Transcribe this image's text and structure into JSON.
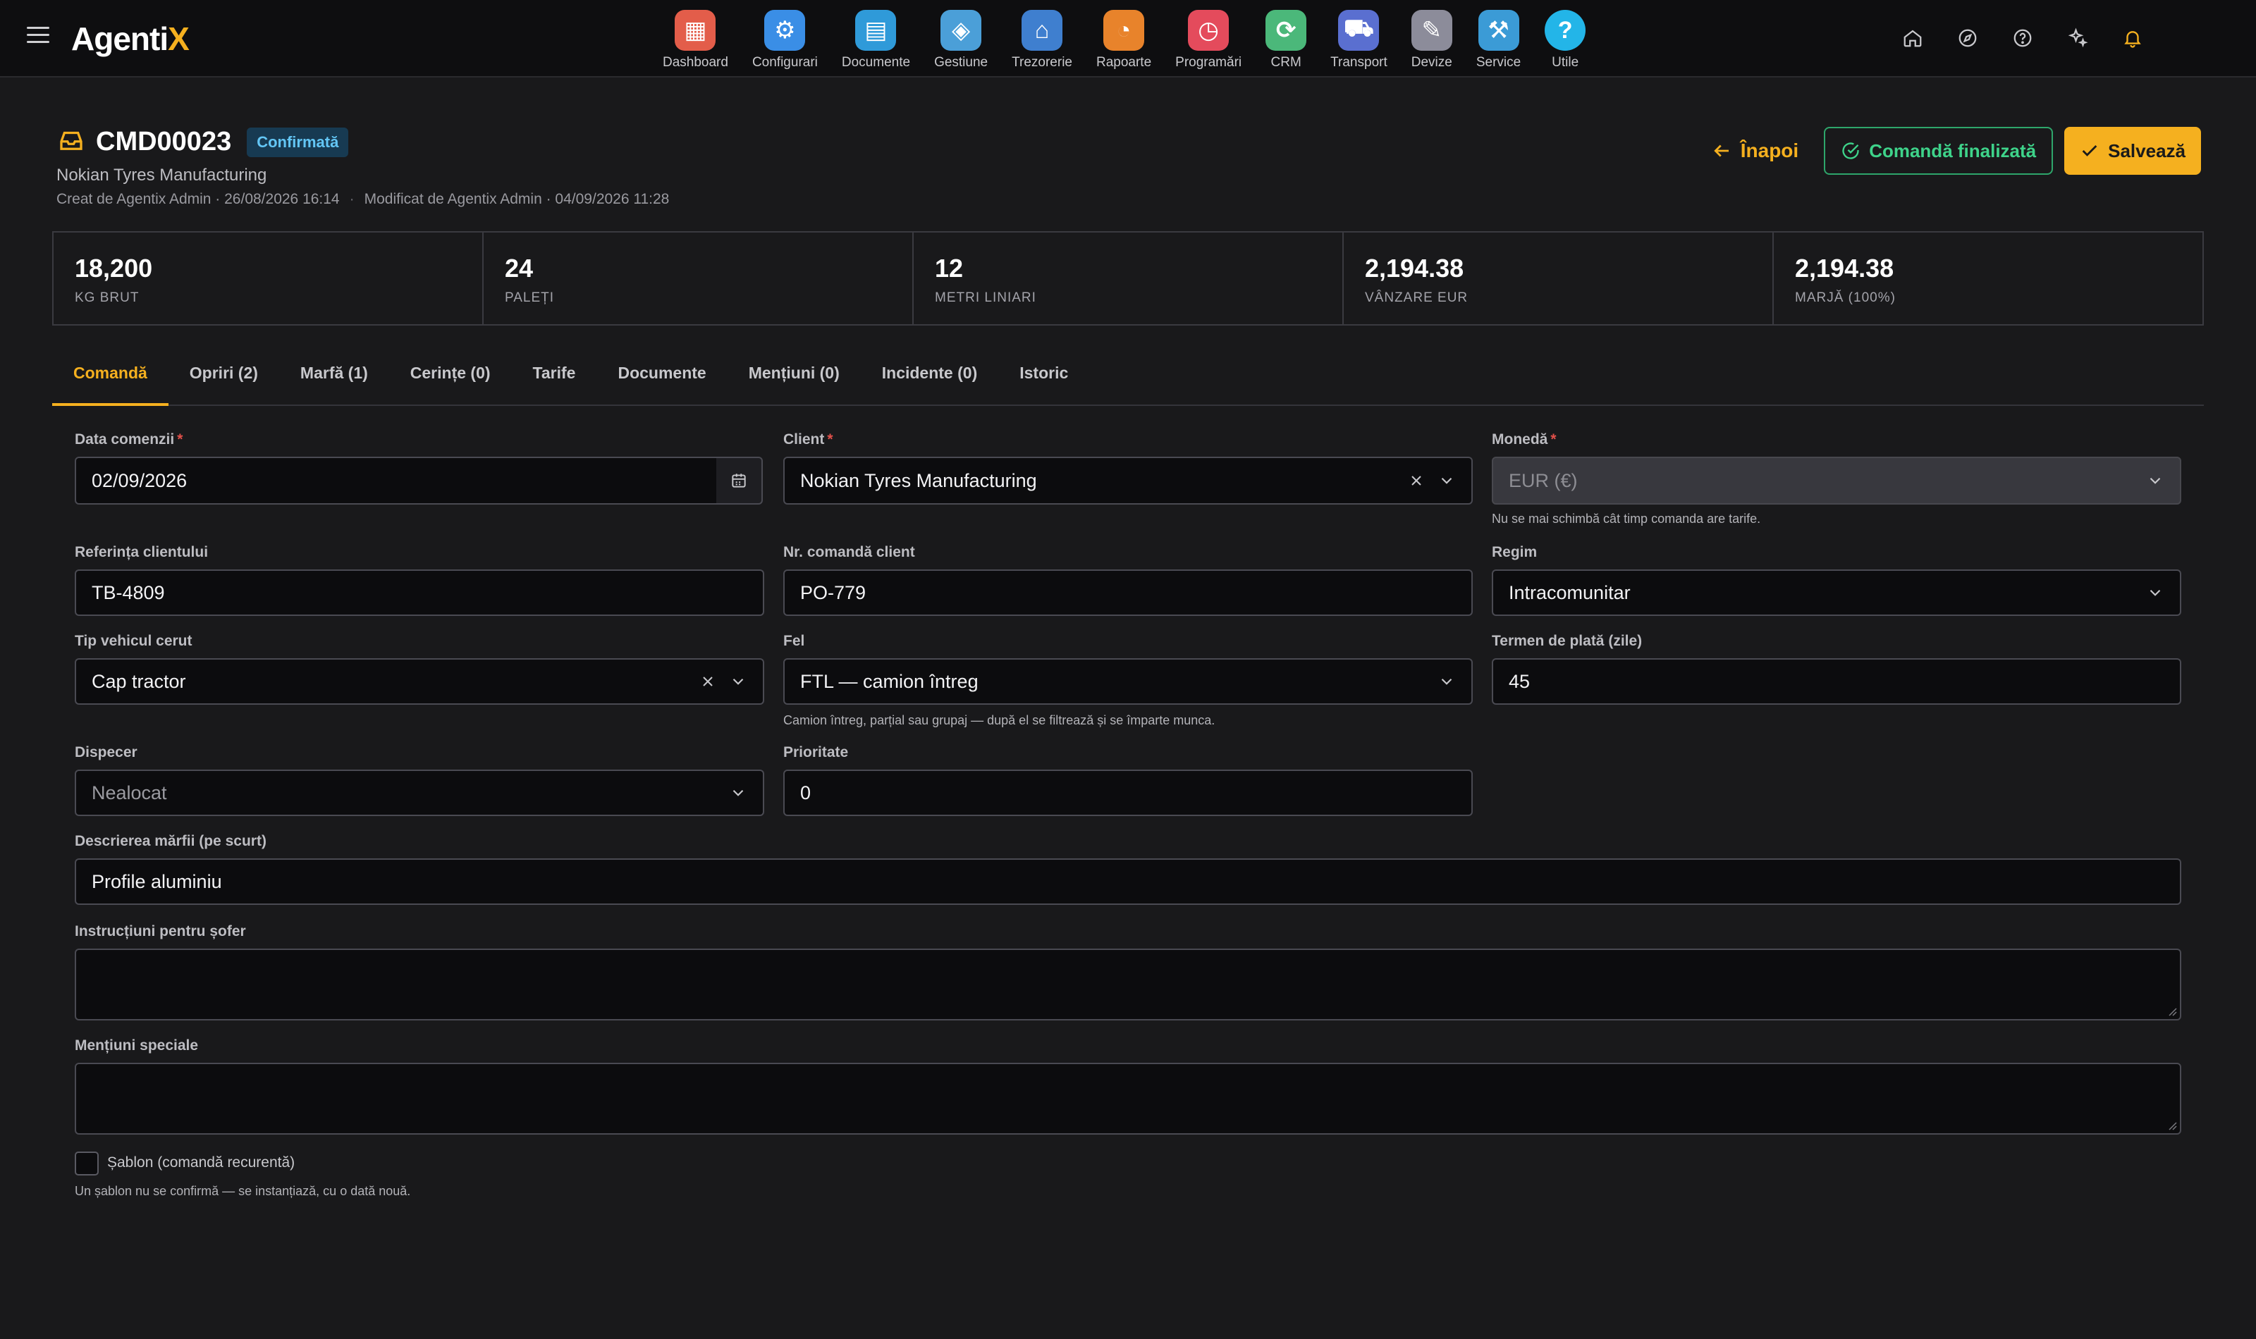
{
  "app": {
    "logo_text": "Agenti",
    "logo_x": "X",
    "accent": "#f5b01f"
  },
  "nav": {
    "modules": [
      {
        "label": "Dashboard",
        "icon": "dashboard-icon",
        "color": "#e35d4a"
      },
      {
        "label": "Configurari",
        "icon": "configurari-icon",
        "color": "#3a8ee6"
      },
      {
        "label": "Documente",
        "icon": "documente-icon",
        "color": "#2f9ad9"
      },
      {
        "label": "Gestiune",
        "icon": "gestiune-icon",
        "color": "#4b9fd8"
      },
      {
        "label": "Trezorerie",
        "icon": "trezorerie-icon",
        "color": "#3f7fcf"
      },
      {
        "label": "Rapoarte",
        "icon": "rapoarte-icon",
        "color": "#e8832b"
      },
      {
        "label": "Programări",
        "icon": "programari-icon",
        "color": "#e44b5c"
      },
      {
        "label": "CRM",
        "icon": "crm-icon",
        "color": "#4bb87a"
      },
      {
        "label": "Transport",
        "icon": "transport-icon",
        "color": "#5a6fd0"
      },
      {
        "label": "Devize",
        "icon": "devize-icon",
        "color": "#8c8c9a"
      },
      {
        "label": "Service",
        "icon": "service-icon",
        "color": "#3b9bd6"
      },
      {
        "label": "Utile",
        "icon": "utile-icon",
        "color": "#23b5e8"
      }
    ]
  },
  "order": {
    "number": "CMD00023",
    "status": "Confirmată",
    "client": "Nokian Tyres Manufacturing",
    "created": "Creat de Agentix Admin · 26/08/2026 16:14",
    "modified": "Modificat de Agentix Admin · 04/09/2026 11:28"
  },
  "actions": {
    "back": "Înapoi",
    "finalized": "Comandă finalizată",
    "save": "Salvează"
  },
  "stats": [
    {
      "value": "18,200",
      "label": "KG BRUT"
    },
    {
      "value": "24",
      "label": "PALEȚI"
    },
    {
      "value": "12",
      "label": "METRI LINIARI"
    },
    {
      "value": "2,194.38",
      "label": "VÂNZARE EUR"
    },
    {
      "value": "2,194.38",
      "label": "MARJĂ (100%)"
    }
  ],
  "tabs": [
    {
      "label": "Comandă"
    },
    {
      "label": "Opriri (2)"
    },
    {
      "label": "Marfă (1)"
    },
    {
      "label": "Cerințe (0)"
    },
    {
      "label": "Tarife"
    },
    {
      "label": "Documente"
    },
    {
      "label": "Mențiuni (0)"
    },
    {
      "label": "Incidente (0)"
    },
    {
      "label": "Istoric"
    }
  ],
  "form": {
    "data_comenzii": {
      "label": "Data comenzii",
      "value": "02/09/2026"
    },
    "client": {
      "label": "Client",
      "value": "Nokian Tyres Manufacturing"
    },
    "moneda": {
      "label": "Monedă",
      "value": "EUR (€)",
      "hint": "Nu se mai schimbă cât timp comanda are tarife."
    },
    "referinta": {
      "label": "Referința clientului",
      "value": "TB-4809"
    },
    "nr_comanda": {
      "label": "Nr. comandă client",
      "value": "PO-779"
    },
    "regim": {
      "label": "Regim",
      "value": "Intracomunitar"
    },
    "tip_vehicul": {
      "label": "Tip vehicul cerut",
      "value": "Cap tractor"
    },
    "fel": {
      "label": "Fel",
      "value": "FTL — camion întreg",
      "hint": "Camion întreg, parțial sau grupaj — după el se filtrează și se împarte munca."
    },
    "termen_plata": {
      "label": "Termen de plată (zile)",
      "value": "45"
    },
    "dispecer": {
      "label": "Dispecer",
      "value": "Nealocat"
    },
    "prioritate": {
      "label": "Prioritate",
      "value": "0"
    },
    "descriere": {
      "label": "Descrierea mărfii (pe scurt)",
      "value": "Profile aluminiu"
    },
    "instructiuni": {
      "label": "Instrucțiuni pentru șofer",
      "value": ""
    },
    "mentiuni": {
      "label": "Mențiuni speciale",
      "value": ""
    },
    "sablon": {
      "label": "Șablon (comandă recurentă)",
      "hint": "Un șablon nu se confirmă — se instanțiază, cu o dată nouă.",
      "checked": false
    }
  }
}
